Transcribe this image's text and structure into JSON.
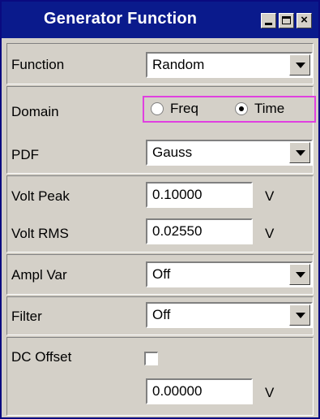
{
  "window": {
    "title": "Generator Function",
    "minimize_icon": "minimize-icon",
    "maximize_icon": "maximize-icon",
    "close_icon": "close-icon",
    "close_glyph": "×"
  },
  "function": {
    "label": "Function",
    "value": "Random"
  },
  "domain": {
    "label": "Domain",
    "options": [
      "Freq",
      "Time"
    ],
    "selected": "Time"
  },
  "pdf": {
    "label": "PDF",
    "value": "Gauss"
  },
  "volt_peak": {
    "label": "Volt Peak",
    "value": "0.10000",
    "unit": "V"
  },
  "volt_rms": {
    "label": "Volt RMS",
    "value": "0.02550",
    "unit": "V"
  },
  "ampl_var": {
    "label": "Ampl Var",
    "value": "Off"
  },
  "filter": {
    "label": "Filter",
    "value": "Off"
  },
  "dc_offset": {
    "label": "DC Offset",
    "checked": false,
    "value": "0.00000",
    "unit": "V"
  },
  "colors": {
    "titlebar": "#0a1a8c",
    "panel": "#d4d0c8",
    "radio_focus": "#e040e0"
  }
}
